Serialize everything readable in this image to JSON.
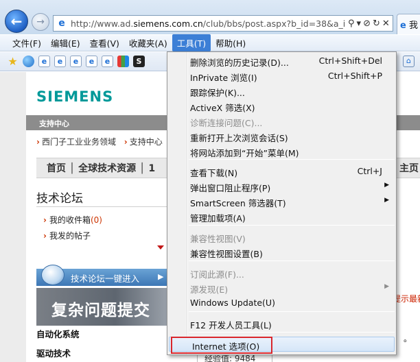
{
  "browser": {
    "url_prefix": "http://www.ad.",
    "url_domain": "siemens.com.cn",
    "url_rest": "/club/bbs/post.aspx?b_id=38&a_id=",
    "tab_label": "我",
    "url_buttons": [
      "⚲",
      "▾",
      "⊘",
      "↻",
      "✕"
    ]
  },
  "menu_bar": {
    "items": [
      "文件(F)",
      "编辑(E)",
      "查看(V)",
      "收藏夹(A)",
      "工具(T)",
      "帮助(H)"
    ],
    "active_index": 4
  },
  "page": {
    "logo": "SIEMENS",
    "gray_band": "支持中心",
    "breadcrumb": [
      "西门子工业业务领域",
      "支持中心"
    ],
    "nav_strip": "首页 │ 全球技术资源 │ 1",
    "nav_strip_right": "主页",
    "forum_title": "技术论坛",
    "links": [
      {
        "label": "我的收件箱",
        "count": "(0)"
      },
      {
        "label": "我发的帖子",
        "count": ""
      }
    ],
    "quick_entry": "技术论坛一键进入",
    "banner_text": "复杂问题提交",
    "side_labels": [
      "自动化系统",
      "驱动技术"
    ],
    "right_red": "提示最新",
    "right_black": "。",
    "experience_box": "经验值: 9484"
  },
  "tools_menu": {
    "items": [
      {
        "label": "删除浏览的历史记录(D)...",
        "shortcut": "Ctrl+Shift+Del",
        "disabled": false
      },
      {
        "label": "InPrivate 浏览(I)",
        "shortcut": "Ctrl+Shift+P",
        "disabled": false
      },
      {
        "label": "跟踪保护(K)...",
        "shortcut": "",
        "disabled": false
      },
      {
        "label": "ActiveX 筛选(X)",
        "shortcut": "",
        "disabled": false
      },
      {
        "label": "诊断连接问题(C)...",
        "shortcut": "",
        "disabled": true
      },
      {
        "label": "重新打开上次浏览会话(S)",
        "shortcut": "",
        "disabled": false
      },
      {
        "label": "将网站添加到“开始”菜单(M)",
        "shortcut": "",
        "disabled": false
      },
      {
        "label": "查看下载(N)",
        "shortcut": "Ctrl+J",
        "disabled": false
      },
      {
        "label": "弹出窗口阻止程序(P)",
        "shortcut": "",
        "disabled": false,
        "submenu": true
      },
      {
        "label": "SmartScreen 筛选器(T)",
        "shortcut": "",
        "disabled": false,
        "submenu": true
      },
      {
        "label": "管理加载项(A)",
        "shortcut": "",
        "disabled": false
      },
      {
        "label": "兼容性视图(V)",
        "shortcut": "",
        "disabled": true
      },
      {
        "label": "兼容性视图设置(B)",
        "shortcut": "",
        "disabled": false
      },
      {
        "label": "订阅此源(F)...",
        "shortcut": "",
        "disabled": true
      },
      {
        "label": "源发现(E)",
        "shortcut": "",
        "disabled": true,
        "submenu": true
      },
      {
        "label": "Windows Update(U)",
        "shortcut": "",
        "disabled": false
      },
      {
        "label": "F12 开发人员工具(L)",
        "shortcut": "",
        "disabled": false
      },
      {
        "label": "Internet 选项(O)",
        "shortcut": "",
        "disabled": false
      }
    ],
    "highlighted_index": 17,
    "submenu_glyph": "▶"
  },
  "colors": {
    "siemens_teal": "#009999",
    "menu_active": "#3c7fd6",
    "focus_outline": "#d9262c"
  }
}
